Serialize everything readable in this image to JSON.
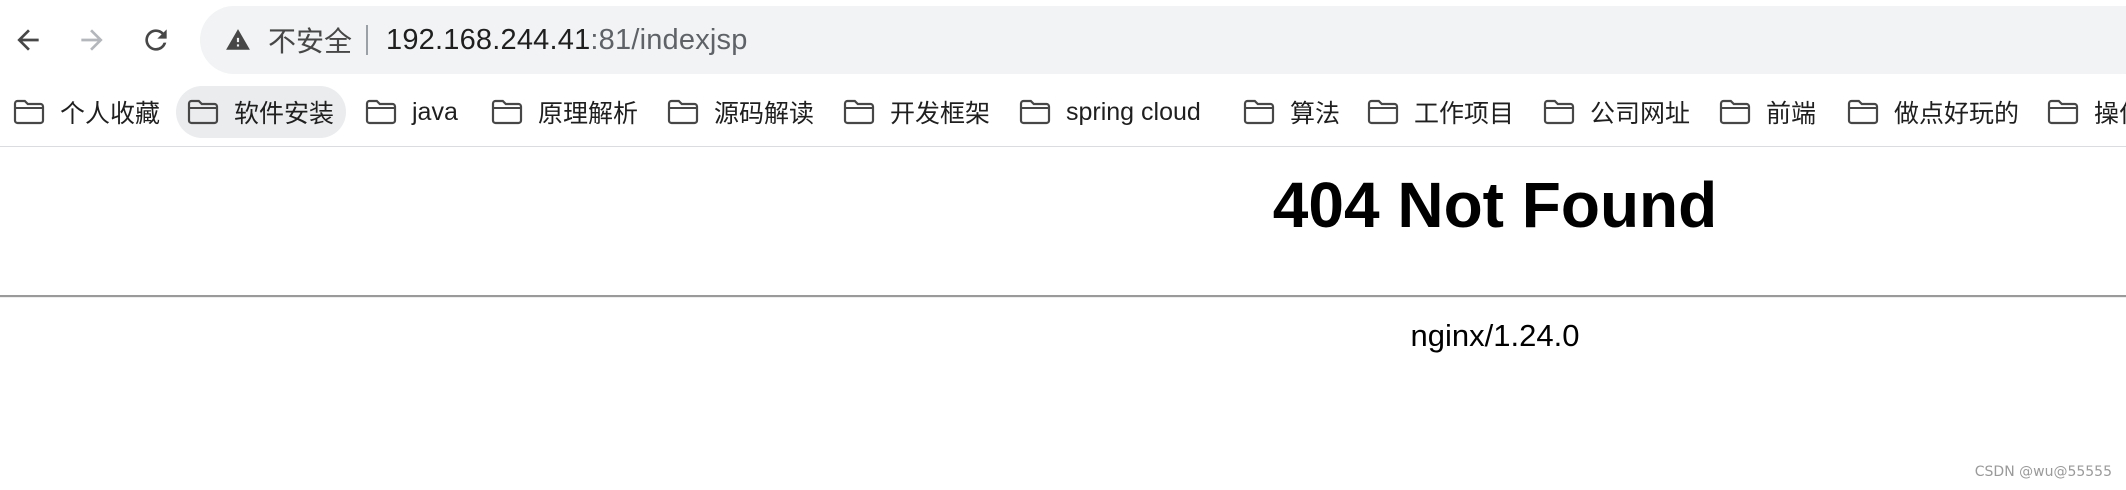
{
  "browser": {
    "nav": {
      "back_icon": "arrow-left-icon",
      "forward_icon": "arrow-right-icon",
      "reload_icon": "reload-icon"
    },
    "omnibox": {
      "security_icon": "warning-triangle-icon",
      "security_label": "不安全",
      "url_host": "192.168.244.41",
      "url_rest": ":81/indexjsp"
    },
    "bookmarks": [
      {
        "label": "个人收藏",
        "icon": "folder-icon"
      },
      {
        "label": "软件安装",
        "icon": "folder-icon",
        "hovered": true
      },
      {
        "label": "java",
        "icon": "folder-icon"
      },
      {
        "label": "原理解析",
        "icon": "folder-icon"
      },
      {
        "label": "源码解读",
        "icon": "folder-icon"
      },
      {
        "label": "开发框架",
        "icon": "folder-icon"
      },
      {
        "label": "spring cloud",
        "icon": "folder-icon"
      },
      {
        "label": "算法",
        "icon": "folder-icon"
      },
      {
        "label": "工作项目",
        "icon": "folder-icon"
      },
      {
        "label": "公司网址",
        "icon": "folder-icon"
      },
      {
        "label": "前端",
        "icon": "folder-icon"
      },
      {
        "label": "做点好玩的",
        "icon": "folder-icon"
      },
      {
        "label": "操作",
        "icon": "folder-icon"
      }
    ]
  },
  "page": {
    "heading": "404 Not Found",
    "server_signature": "nginx/1.24.0"
  },
  "watermark": "CSDN @wu@55555",
  "colors": {
    "omnibox_bg": "#f1f3f4",
    "hover_bg": "#eaecee",
    "text": "#1f1f1f",
    "icon": "#474747"
  }
}
